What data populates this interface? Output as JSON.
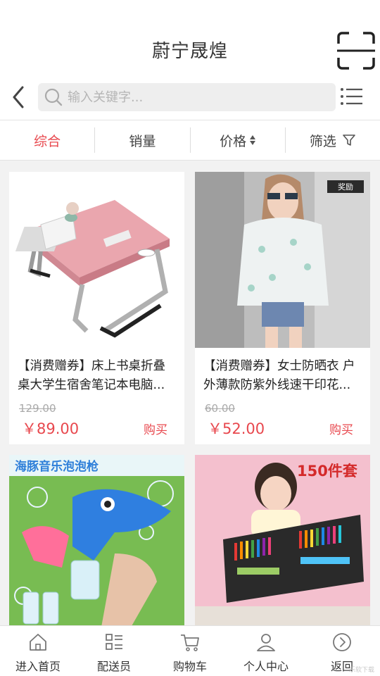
{
  "header": {
    "title": "蔚宁晟煌"
  },
  "search": {
    "placeholder": "输入关键字..."
  },
  "filters": [
    {
      "label": "综合",
      "active": true
    },
    {
      "label": "销量",
      "active": false
    },
    {
      "label": "价格",
      "active": false
    },
    {
      "label": "筛选",
      "active": false
    }
  ],
  "products": [
    {
      "name": "【消费赠券】床上书桌折叠桌大学生宿舍笔记本电脑...",
      "original_price": "129.00",
      "price": "￥89.00",
      "buy_label": "购买"
    },
    {
      "name": "【消费赠券】女士防晒衣 户外薄款防紫外线速干印花...",
      "original_price": "60.00",
      "price": "￥52.00",
      "buy_label": "购买",
      "image_badge": "奖励"
    },
    {
      "image_text": "海豚音乐泡泡枪"
    },
    {
      "image_text": "150件套"
    }
  ],
  "tabbar": [
    {
      "label": "进入首页",
      "icon": "home-icon"
    },
    {
      "label": "配送员",
      "icon": "list-icon"
    },
    {
      "label": "购物车",
      "icon": "cart-icon"
    },
    {
      "label": "个人中心",
      "icon": "user-icon"
    },
    {
      "label": "返回",
      "icon": "back-circle-icon"
    }
  ],
  "corner_text": "乐软下载",
  "colors": {
    "accent": "#e8484e",
    "background": "#f2f2f2",
    "card": "#ffffff"
  }
}
